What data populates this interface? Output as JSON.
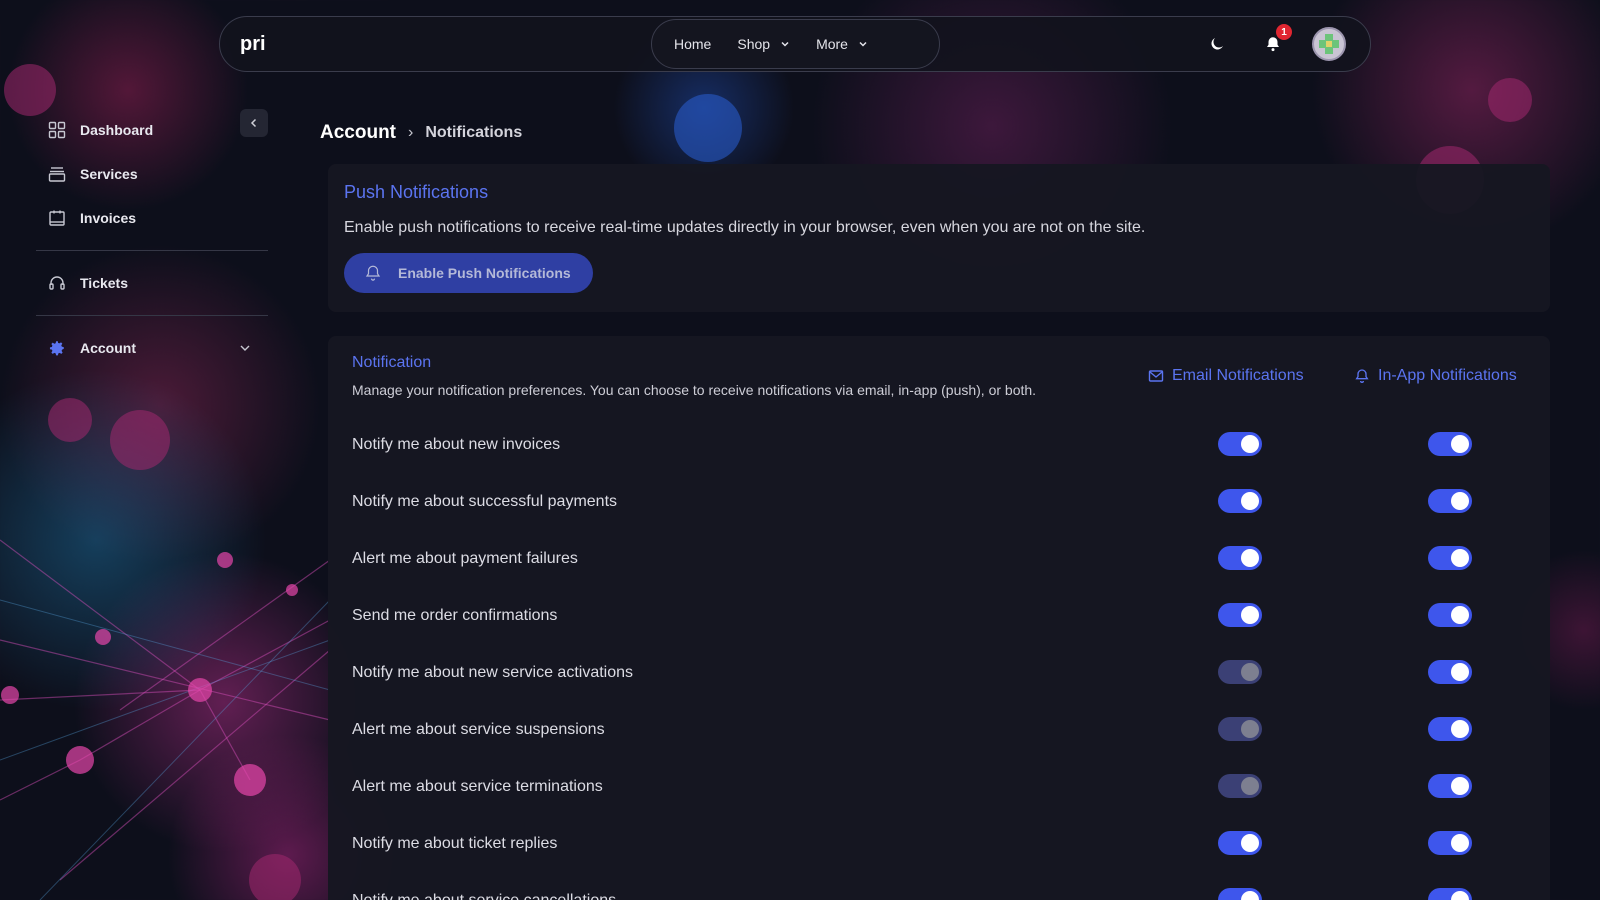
{
  "brand": "pri",
  "nav": {
    "items": [
      {
        "label": "Home",
        "dropdown": false
      },
      {
        "label": "Shop",
        "dropdown": true
      },
      {
        "label": "More",
        "dropdown": true
      }
    ],
    "notification_count": "1",
    "icons": [
      "moon-icon",
      "bell-icon",
      "avatar"
    ]
  },
  "sidebar": {
    "items": [
      {
        "label": "Dashboard",
        "icon": "grid-icon"
      },
      {
        "label": "Services",
        "icon": "stack-icon"
      },
      {
        "label": "Invoices",
        "icon": "receipt-icon"
      },
      {
        "label": "Tickets",
        "icon": "headset-icon"
      },
      {
        "label": "Account",
        "icon": "gear-icon",
        "expandable": true
      }
    ]
  },
  "breadcrumb": {
    "root": "Account",
    "separator": "›",
    "current": "Notifications"
  },
  "push": {
    "title": "Push Notifications",
    "description": "Enable push notifications to receive real-time updates directly in your browser, even when you are not on the site.",
    "button_label": "Enable Push Notifications"
  },
  "preferences": {
    "title": "Notification",
    "description": "Manage your notification preferences. You can choose to receive notifications via email, in-app (push), or both.",
    "email_header": "Email Notifications",
    "inapp_header": "In-App Notifications",
    "rows": [
      {
        "label": "Notify me about new invoices",
        "email": true,
        "inapp": true
      },
      {
        "label": "Notify me about successful payments",
        "email": true,
        "inapp": true
      },
      {
        "label": "Alert me about payment failures",
        "email": true,
        "inapp": true
      },
      {
        "label": "Send me order confirmations",
        "email": true,
        "inapp": true
      },
      {
        "label": "Notify me about new service activations",
        "email": false,
        "inapp": true
      },
      {
        "label": "Alert me about service suspensions",
        "email": false,
        "inapp": true
      },
      {
        "label": "Alert me about service terminations",
        "email": false,
        "inapp": true
      },
      {
        "label": "Notify me about ticket replies",
        "email": true,
        "inapp": true
      },
      {
        "label": "Notify me about service cancellations",
        "email": true,
        "inapp": true
      }
    ]
  },
  "colors": {
    "accent": "#3e56ec",
    "accent_text": "#5b74f0",
    "toggle_off": "#3b4075",
    "badge": "#e02631",
    "background": "#0d0f1b",
    "card": "#161721"
  }
}
